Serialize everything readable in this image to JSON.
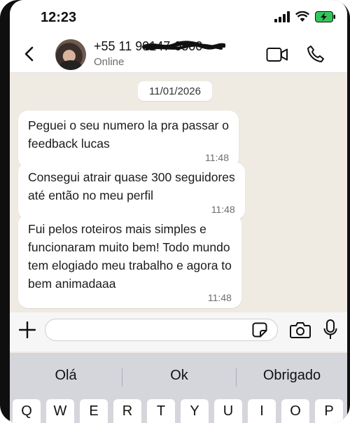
{
  "status_bar": {
    "time": "12:23",
    "icons": [
      "signal-icon",
      "wifi-icon",
      "battery-charging-icon"
    ]
  },
  "header": {
    "contact_name": "+55 11 99147-0500",
    "presence": "Online",
    "icons": [
      "back-arrow-icon",
      "avatar",
      "video-call-icon",
      "phone-icon"
    ]
  },
  "chat": {
    "date_separator": "11/01/2026",
    "messages": [
      {
        "text": "Peguei o seu numero la pra passar o\nfeedback lucas",
        "time": "11:48"
      },
      {
        "text": "Consegui atrair quase 300 seguidores\naté então no meu perfil",
        "time": "11:48"
      },
      {
        "text": "Fui pelos roteiros mais simples e\nfuncionaram muito bem! Todo mundo\ntem elogiado meu trabalho e agora to\nbem animadaaa",
        "time": "11:48"
      }
    ]
  },
  "composer": {
    "value": "",
    "icons": [
      "plus-icon",
      "sticker-icon",
      "camera-icon",
      "microphone-icon"
    ]
  },
  "suggestions": [
    "Olá",
    "Ok",
    "Obrigado"
  ],
  "keyboard": {
    "row1": [
      "Q",
      "W",
      "E",
      "R",
      "T",
      "Y",
      "U",
      "I",
      "O",
      "P"
    ]
  },
  "colors": {
    "chat_background": "#efeae2",
    "bubble": "#ffffff",
    "battery_green": "#33c759",
    "keyboard": "#d4d6db"
  }
}
